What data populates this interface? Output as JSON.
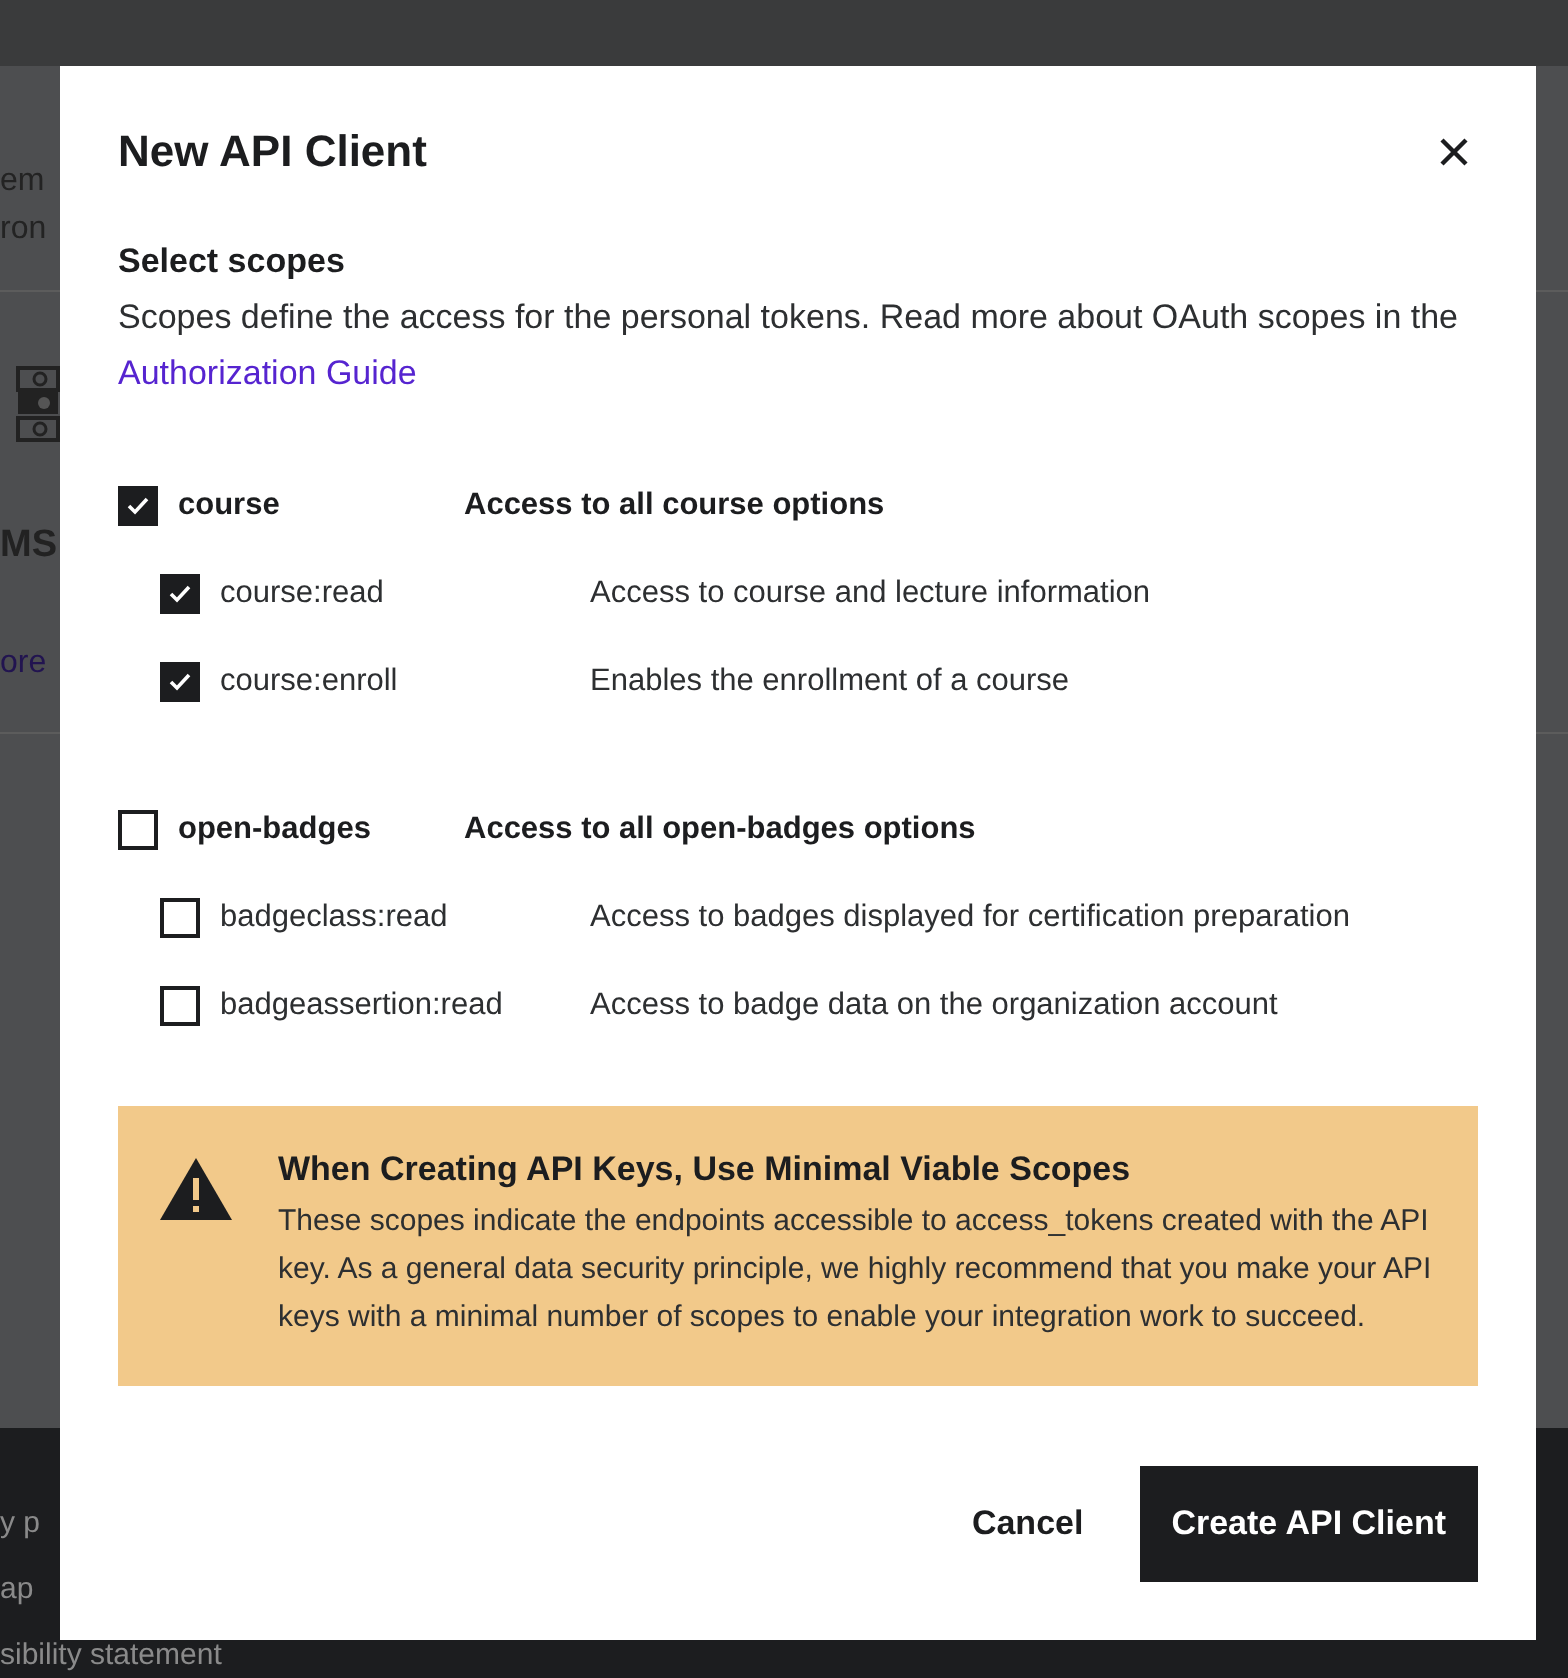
{
  "background": {
    "fragments_top": [
      "em",
      "ron"
    ],
    "heading": "MS",
    "link": "ore",
    "footer_links": [
      "y p",
      "ap",
      "sibility statement"
    ]
  },
  "dialog": {
    "title": "New API Client",
    "section_title": "Select scopes",
    "intro": "Scopes define the access for the personal tokens. Read more about OAuth scopes in the ",
    "intro_link": "Authorization Guide",
    "scopes": [
      {
        "name": "course",
        "description": "Access to all course options",
        "checked": true,
        "children": [
          {
            "name": "course:read",
            "description": "Access to course and lecture information",
            "checked": true
          },
          {
            "name": "course:enroll",
            "description": "Enables the enrollment of a course",
            "checked": true
          }
        ]
      },
      {
        "name": "open-badges",
        "description": "Access to all open-badges options",
        "checked": false,
        "children": [
          {
            "name": "badgeclass:read",
            "description": "Access to badges displayed for certification preparation",
            "checked": false
          },
          {
            "name": "badgeassertion:read",
            "description": "Access to badge data on the organization account",
            "checked": false
          }
        ]
      }
    ],
    "warning": {
      "title": "When Creating API Keys, Use Minimal Viable Scopes",
      "body": "These scopes indicate the endpoints accessible to access_tokens created with the API key. As a general data security principle, we highly recommend that you make your API keys with a minimal number of scopes to enable your integration work to succeed."
    },
    "buttons": [
      {
        "label": "Cancel",
        "kind": "secondary"
      },
      {
        "label": "Create API Client",
        "kind": "primary"
      }
    ]
  }
}
